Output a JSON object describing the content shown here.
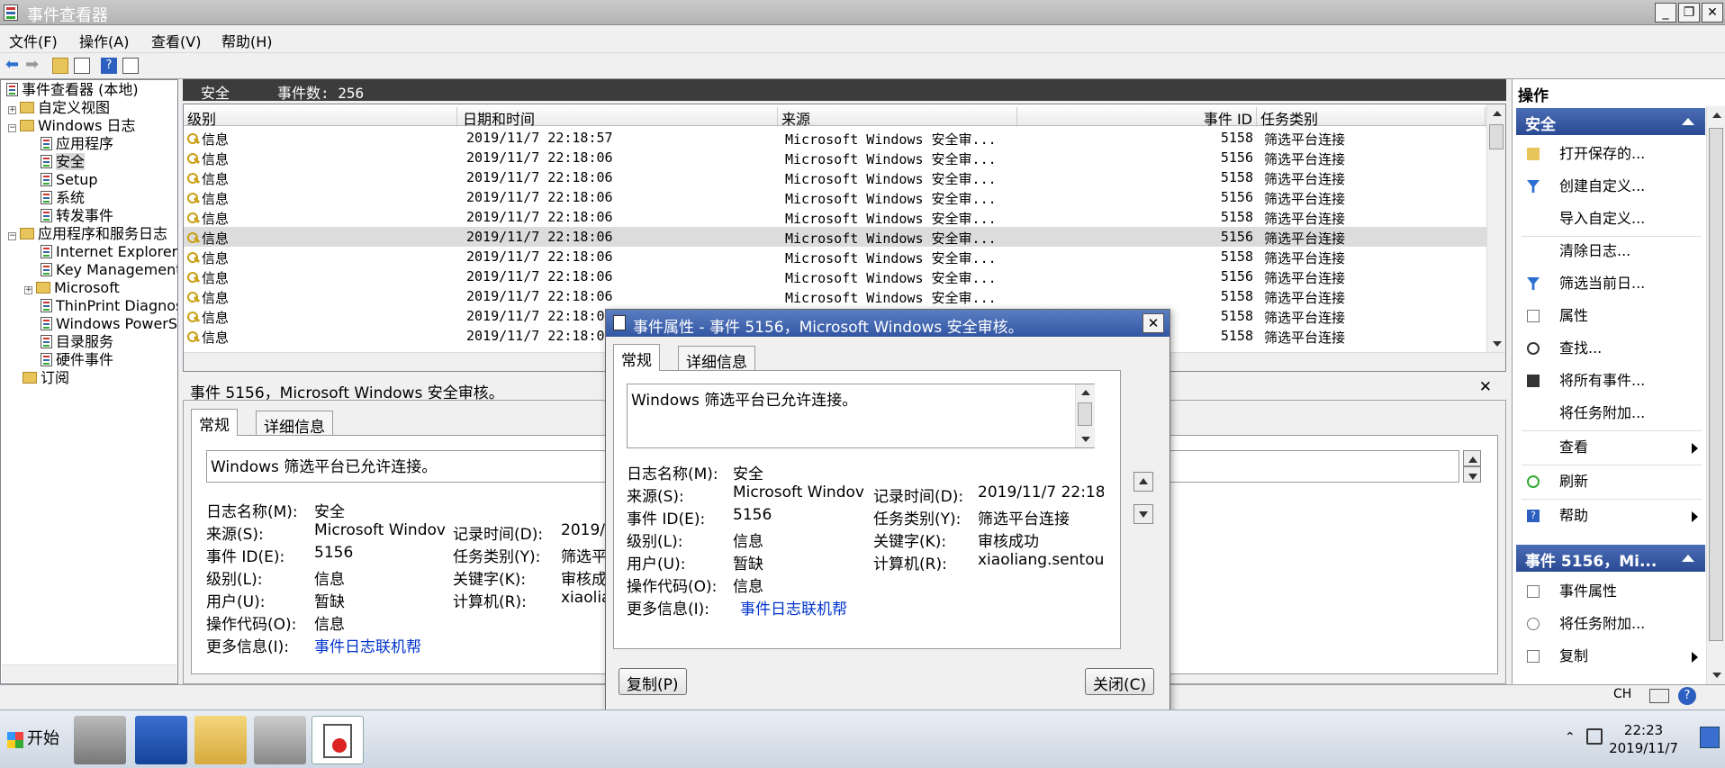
{
  "window": {
    "title": "事件查看器"
  },
  "menu": [
    "文件(F)",
    "操作(A)",
    "查看(V)",
    "帮助(H)"
  ],
  "tree": [
    {
      "label": "事件查看器 (本地)",
      "level": 0
    },
    {
      "label": "自定义视图",
      "level": 1
    },
    {
      "label": "Windows 日志",
      "level": 1
    },
    {
      "label": "应用程序",
      "level": 2
    },
    {
      "label": "安全",
      "level": 2
    },
    {
      "label": "Setup",
      "level": 2
    },
    {
      "label": "系统",
      "level": 2
    },
    {
      "label": "转发事件",
      "level": 2
    },
    {
      "label": "应用程序和服务日志",
      "level": 1
    },
    {
      "label": "Internet Explorer",
      "level": 2
    },
    {
      "label": "Key Management",
      "level": 2
    },
    {
      "label": "Microsoft",
      "level": 2
    },
    {
      "label": "ThinPrint Diagnostics",
      "level": 2
    },
    {
      "label": "Windows PowerShell",
      "level": 2
    },
    {
      "label": "目录服务",
      "level": 2
    },
    {
      "label": "硬件事件",
      "level": 2
    },
    {
      "label": "订阅",
      "level": 1
    }
  ],
  "center": {
    "log_name": "安全",
    "event_count": "事件数: 256"
  },
  "grid": {
    "columns": [
      "级别",
      "日期和时间",
      "来源",
      "事件 ID",
      "任务类别"
    ],
    "rows": [
      {
        "level": "信息",
        "datetime": "2019/11/7 22:18:57",
        "source": "Microsoft Windows 安全审...",
        "id": "5158",
        "task": "筛选平台连接"
      },
      {
        "level": "信息",
        "datetime": "2019/11/7 22:18:06",
        "source": "Microsoft Windows 安全审...",
        "id": "5156",
        "task": "筛选平台连接"
      },
      {
        "level": "信息",
        "datetime": "2019/11/7 22:18:06",
        "source": "Microsoft Windows 安全审...",
        "id": "5158",
        "task": "筛选平台连接"
      },
      {
        "level": "信息",
        "datetime": "2019/11/7 22:18:06",
        "source": "Microsoft Windows 安全审...",
        "id": "5156",
        "task": "筛选平台连接"
      },
      {
        "level": "信息",
        "datetime": "2019/11/7 22:18:06",
        "source": "Microsoft Windows 安全审...",
        "id": "5158",
        "task": "筛选平台连接"
      },
      {
        "level": "信息",
        "datetime": "2019/11/7 22:18:06",
        "source": "Microsoft Windows 安全审...",
        "id": "5156",
        "task": "筛选平台连接"
      },
      {
        "level": "信息",
        "datetime": "2019/11/7 22:18:06",
        "source": "Microsoft Windows 安全审...",
        "id": "5158",
        "task": "筛选平台连接"
      },
      {
        "level": "信息",
        "datetime": "2019/11/7 22:18:06",
        "source": "Microsoft Windows 安全审...",
        "id": "5156",
        "task": "筛选平台连接"
      },
      {
        "level": "信息",
        "datetime": "2019/11/7 22:18:06",
        "source": "Microsoft Windows 安全审...",
        "id": "5158",
        "task": "筛选平台连接"
      },
      {
        "level": "信息",
        "datetime": "2019/11/7 22:18:0",
        "source": "",
        "id": "5158",
        "task": "筛选平台连接"
      },
      {
        "level": "信息",
        "datetime": "2019/11/7 22:18:0",
        "source": "",
        "id": "5158",
        "task": "筛选平台连接"
      }
    ]
  },
  "detail": {
    "header": "事件 5156，Microsoft Windows 安全审核。",
    "tab_general": "常规",
    "tab_details": "详细信息",
    "message": "Windows 筛选平台已允许连接。",
    "log_name_label": "日志名称(M):",
    "log_name_value": "安全",
    "source_label": "来源(S):",
    "source_value": "Microsoft Windov",
    "logged_label": "记录时间(D):",
    "logged_value": "2019/",
    "eventid_label": "事件 ID(E):",
    "eventid_value": "5156",
    "task_label": "任务类别(Y):",
    "task_value": "筛选平",
    "level_label": "级别(L):",
    "level_value": "信息",
    "keywords_label": "关键字(K):",
    "keywords_value": "审核成",
    "user_label": "用户(U):",
    "user_value": "暂缺",
    "computer_label": "计算机(R):",
    "computer_value": "xiaolia",
    "opcode_label": "操作代码(O):",
    "opcode_value": "信息",
    "more_label": "更多信息(I):",
    "more_link": "事件日志联机帮"
  },
  "dialog": {
    "title": "事件属性 - 事件 5156，Microsoft Windows 安全审核。",
    "tab_general": "常规",
    "tab_details": "详细信息",
    "message": "Windows 筛选平台已允许连接。",
    "log_name_label": "日志名称(M):",
    "log_name_value": "安全",
    "source_label": "来源(S):",
    "source_value": "Microsoft Windov",
    "logged_label": "记录时间(D):",
    "logged_value": "2019/11/7 22:18",
    "eventid_label": "事件 ID(E):",
    "eventid_value": "5156",
    "task_label": "任务类别(Y):",
    "task_value": "筛选平台连接",
    "level_label": "级别(L):",
    "level_value": "信息",
    "keywords_label": "关键字(K):",
    "keywords_value": "审核成功",
    "user_label": "用户(U):",
    "user_value": "暂缺",
    "computer_label": "计算机(R):",
    "computer_value": "xiaoliang.sentou",
    "opcode_label": "操作代码(O):",
    "opcode_value": "信息",
    "more_label": "更多信息(I):",
    "more_link": "事件日志联机帮",
    "copy_button": "复制(P)",
    "close_button": "关闭(C)"
  },
  "actions": {
    "title": "操作",
    "section1": "安全",
    "items1": [
      "打开保存的...",
      "创建自定义...",
      "导入自定义...",
      "清除日志...",
      "筛选当前日...",
      "属性",
      "查找...",
      "将所有事件...",
      "将任务附加...",
      "查看",
      "刷新",
      "帮助"
    ],
    "section2": "事件 5156，Mi...",
    "items2": [
      "事件属性",
      "将任务附加...",
      "复制"
    ]
  },
  "taskbar": {
    "start": "开始",
    "lang": "CH",
    "time": "22:23",
    "date": "2019/11/7"
  },
  "colors": {
    "accent": "#3356a4",
    "link": "#0033cc",
    "selected_row": "#dcdcdc"
  }
}
